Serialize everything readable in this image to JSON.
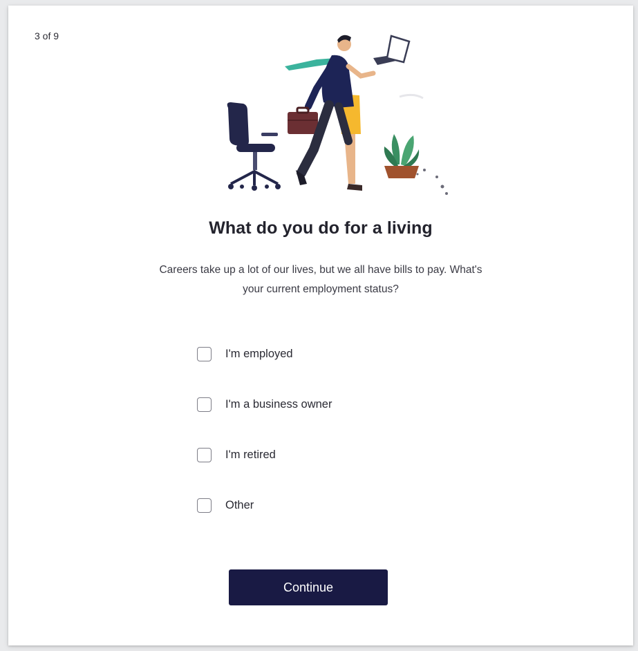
{
  "progress": {
    "text": "3 of 9",
    "current": 3,
    "total": 9
  },
  "illustration": {
    "icon": "person-leaving-office-illustration",
    "colors": {
      "navy": "#1d2456",
      "teal": "#3bb39d",
      "yellow": "#f5b82e",
      "briefcase": "#6b2f33",
      "plant": "#3a8f62",
      "pot": "#a0522d"
    }
  },
  "question": {
    "title": "What do you do for a living",
    "subtitle_line1": "Careers take up a lot of our lives, but we all have bills to pay. What's",
    "subtitle_line2": "your current employment status?"
  },
  "options": [
    {
      "label": "I'm employed",
      "checked": false
    },
    {
      "label": "I'm a business owner",
      "checked": false
    },
    {
      "label": "I'm retired",
      "checked": false
    },
    {
      "label": "Other",
      "checked": false
    }
  ],
  "actions": {
    "continue_label": "Continue",
    "continue_color": "#191a44"
  }
}
